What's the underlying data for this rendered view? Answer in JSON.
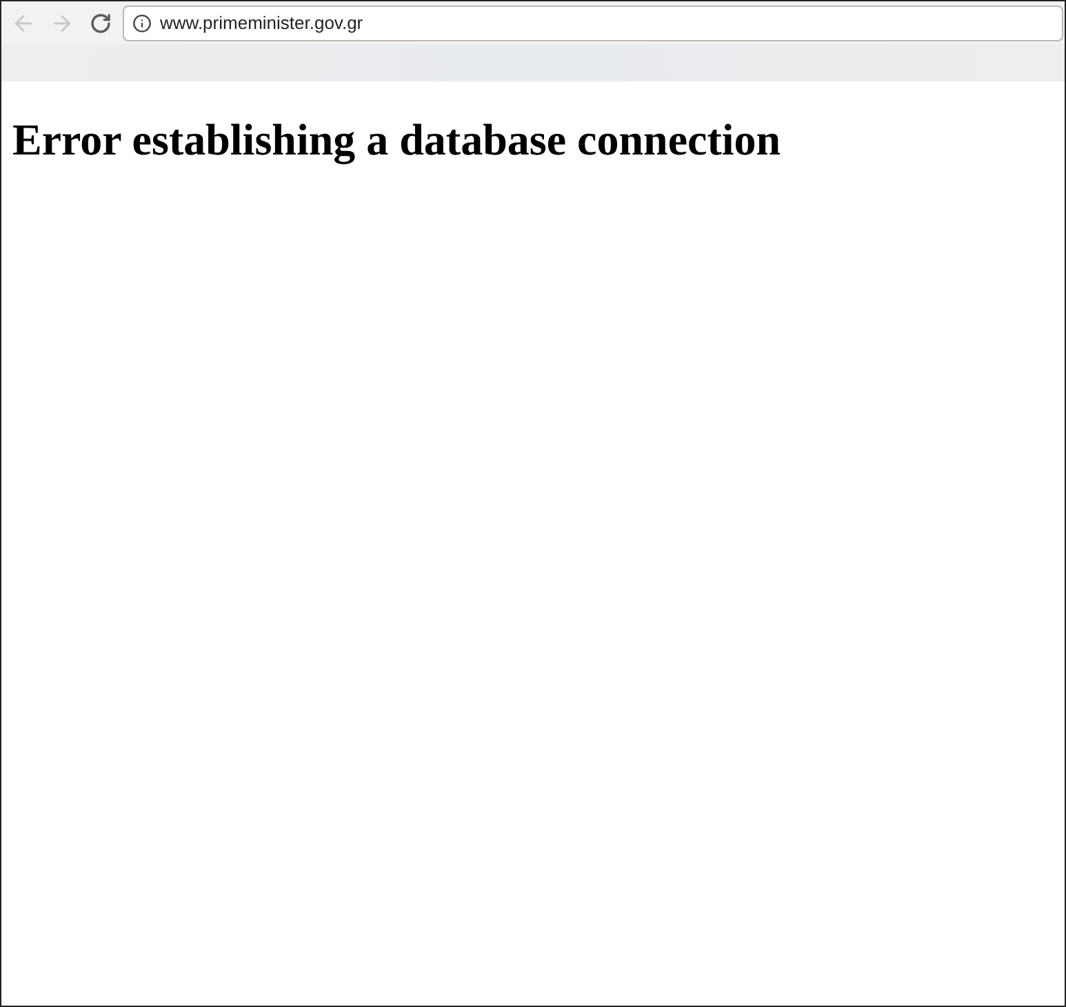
{
  "toolbar": {
    "back": {
      "disabled": true
    },
    "forward": {
      "disabled": true
    },
    "address": "www.primeminister.gov.gr"
  },
  "page": {
    "heading": "Error establishing a database connection"
  }
}
